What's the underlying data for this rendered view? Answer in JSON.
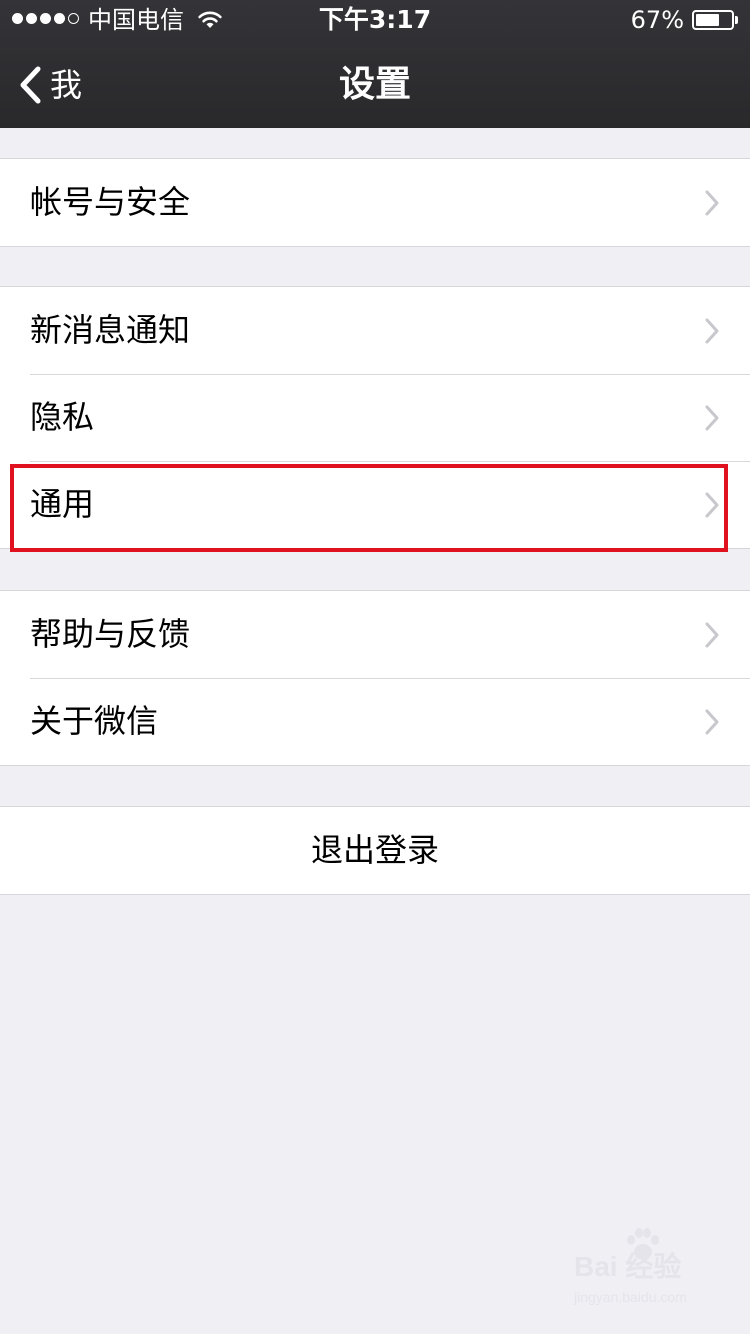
{
  "status_bar": {
    "carrier": "中国电信",
    "time": "下午3:17",
    "battery_percent": "67%",
    "battery_level": 0.67,
    "signal_bars_filled": 4,
    "signal_bars_total": 5,
    "wifi_icon": "wifi-icon"
  },
  "nav": {
    "back_label": "我",
    "back_icon": "chevron-left-icon",
    "title": "设置"
  },
  "groups": [
    {
      "rows": [
        {
          "label": "帐号与安全"
        }
      ]
    },
    {
      "rows": [
        {
          "label": "新消息通知"
        },
        {
          "label": "隐私"
        },
        {
          "label": "通用"
        }
      ]
    },
    {
      "rows": [
        {
          "label": "帮助与反馈"
        },
        {
          "label": "关于微信"
        }
      ]
    }
  ],
  "logout_label": "退出登录",
  "highlighted_row": "通用",
  "watermark": {
    "main": "Bai 经验",
    "url": "jingyan.baidu.com"
  },
  "colors": {
    "nav_background": "#2e2e31",
    "page_background": "#efeff4",
    "highlight_border": "#e0121f",
    "chevron": "#c7c7cc"
  }
}
